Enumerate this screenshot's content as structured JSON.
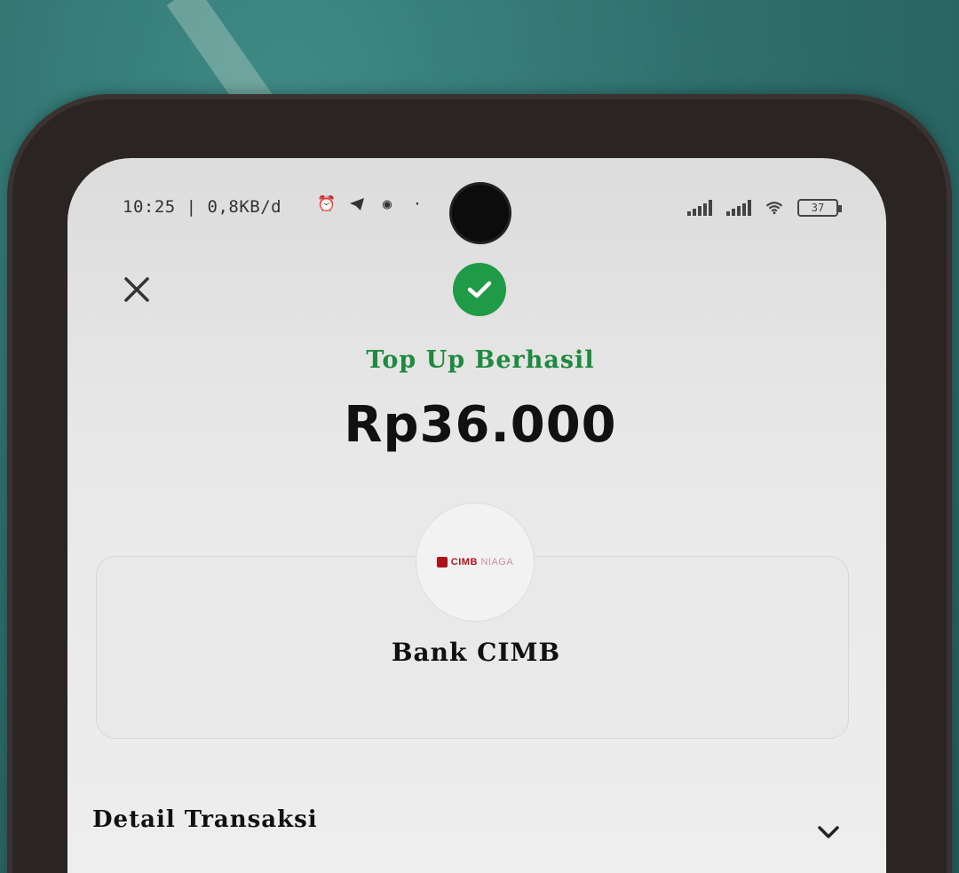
{
  "status_bar": {
    "time_speed": "10:25 | 0,8KB/d",
    "battery": "37"
  },
  "header": {
    "close_icon": "close-icon",
    "success_icon": "check-circle-icon",
    "success_color": "#1f9a46"
  },
  "transaction": {
    "status": "Top Up Berhasil",
    "amount": "Rp36.000"
  },
  "bank": {
    "logo_text": "CIMB",
    "logo_text_light": "NIAGA",
    "name": "Bank CIMB"
  },
  "details": {
    "header": "Detail Transaksi"
  }
}
